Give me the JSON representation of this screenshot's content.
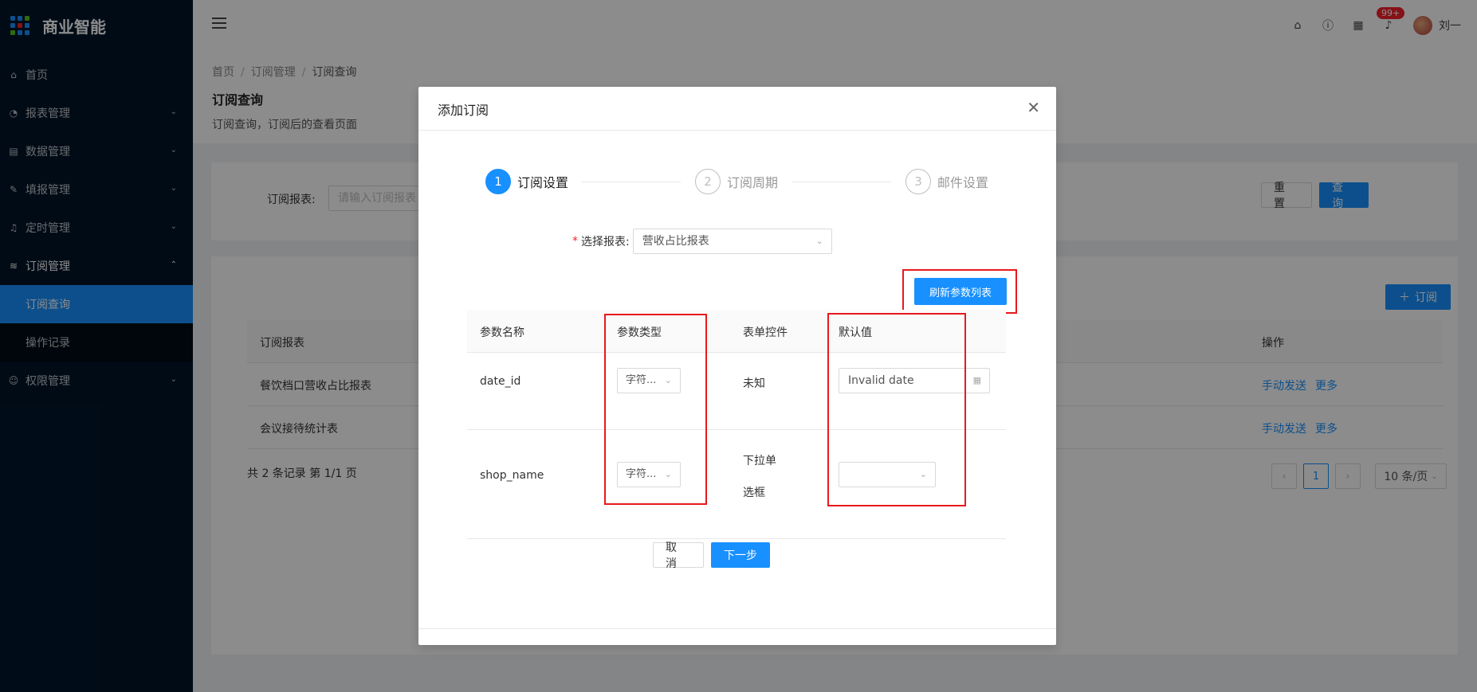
{
  "app": {
    "name": "商业智能"
  },
  "sidebar": {
    "items": [
      {
        "label": "首页",
        "icon": "bank-icon"
      },
      {
        "label": "报表管理",
        "icon": "dashboard-icon"
      },
      {
        "label": "数据管理",
        "icon": "database-icon"
      },
      {
        "label": "填报管理",
        "icon": "edit-icon"
      },
      {
        "label": "定时管理",
        "icon": "bell-icon"
      },
      {
        "label": "订阅管理",
        "icon": "wifi-icon"
      },
      {
        "label": "权限管理",
        "icon": "user-icon"
      }
    ],
    "subitems": [
      {
        "label": "订阅查询"
      },
      {
        "label": "操作记录"
      }
    ]
  },
  "header": {
    "badge": "99+",
    "user": "刘一"
  },
  "page": {
    "breadcrumb": [
      "首页",
      "订阅管理",
      "订阅查询"
    ],
    "title": "订阅查询",
    "desc": "订阅查询，订阅后的查看页面"
  },
  "filter": {
    "label": "订阅报表:",
    "placeholder": "请输入订阅报表",
    "reset": "重 置",
    "query": "查 询"
  },
  "list": {
    "subscribe": "订阅",
    "columns": {
      "report": "订阅报表",
      "action": "操作"
    },
    "rows": [
      {
        "report": "餐饮档口营收占比报表",
        "send": "手动发送",
        "more": "更多"
      },
      {
        "report": "会议接待统计表",
        "send": "手动发送",
        "more": "更多"
      }
    ],
    "total": "共 2 条记录 第 1/1 页",
    "page": "1",
    "page_size": "10 条/页"
  },
  "modal": {
    "title": "添加订阅",
    "steps": [
      {
        "num": "1",
        "label": "订阅设置"
      },
      {
        "num": "2",
        "label": "订阅周期"
      },
      {
        "num": "3",
        "label": "邮件设置"
      }
    ],
    "report_label": "选择报表:",
    "report_value": "营收占比报表",
    "refresh": "刷新参数列表",
    "columns": [
      "参数名称",
      "参数类型",
      "表单控件",
      "默认值"
    ],
    "rows": [
      {
        "name": "date_id",
        "type": "字符...",
        "control": "未知",
        "default": "Invalid date"
      },
      {
        "name": "shop_name",
        "type": "字符...",
        "control_1": "下拉单",
        "control_2": "选框",
        "default": ""
      }
    ],
    "cancel": "取 消",
    "next": "下一步"
  }
}
